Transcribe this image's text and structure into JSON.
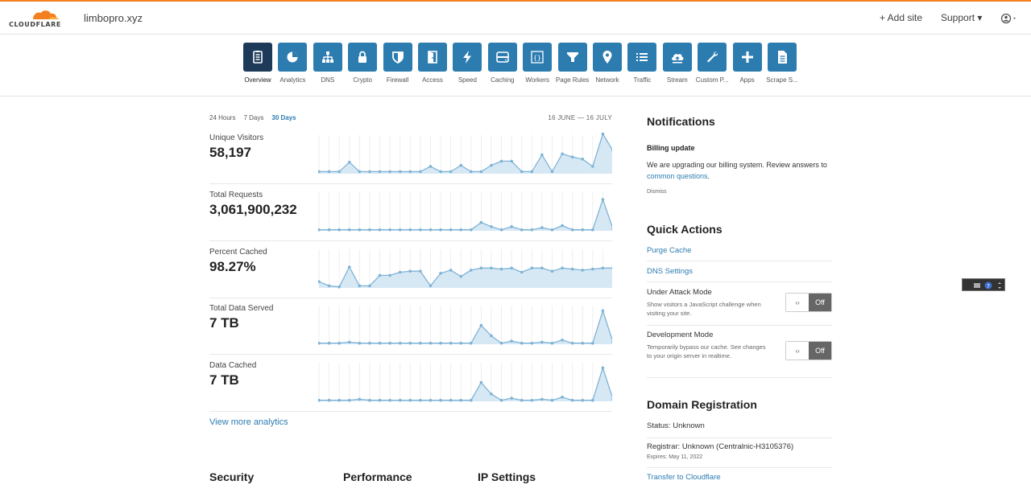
{
  "header": {
    "logo_text": "CLOUDFLARE",
    "domain": "limbopro.xyz",
    "add_site": "+ Add site",
    "support": "Support ▾",
    "account_icon": "user-circle-icon"
  },
  "nav": [
    {
      "label": "Overview",
      "icon": "overview-icon",
      "active": true
    },
    {
      "label": "Analytics",
      "icon": "pie-chart-icon"
    },
    {
      "label": "DNS",
      "icon": "network-tree-icon"
    },
    {
      "label": "Crypto",
      "icon": "lock-icon"
    },
    {
      "label": "Firewall",
      "icon": "shield-icon"
    },
    {
      "label": "Access",
      "icon": "door-icon"
    },
    {
      "label": "Speed",
      "icon": "lightning-icon"
    },
    {
      "label": "Caching",
      "icon": "drive-icon"
    },
    {
      "label": "Workers",
      "icon": "code-braces-icon"
    },
    {
      "label": "Page Rules",
      "icon": "filter-icon"
    },
    {
      "label": "Network",
      "icon": "location-pin-icon"
    },
    {
      "label": "Traffic",
      "icon": "list-icon"
    },
    {
      "label": "Stream",
      "icon": "cloud-upload-icon"
    },
    {
      "label": "Custom P...",
      "icon": "wrench-icon"
    },
    {
      "label": "Apps",
      "icon": "plus-icon"
    },
    {
      "label": "Scrape S...",
      "icon": "document-icon"
    }
  ],
  "analytics": {
    "ranges": [
      "24 Hours",
      "7 Days",
      "30 Days"
    ],
    "active_range": "30 Days",
    "date_range": "16 JUNE — 16 JULY",
    "view_more": "View more analytics",
    "stats": [
      {
        "label": "Unique Visitors",
        "value": "58,197",
        "series": [
          0.1,
          0.1,
          0.1,
          0.55,
          0.1,
          0.1,
          0.1,
          0.1,
          0.1,
          0.1,
          0.1,
          0.35,
          0.1,
          0.1,
          0.4,
          0.1,
          0.1,
          0.4,
          0.6,
          0.6,
          0.1,
          0.1,
          0.9,
          0.1,
          0.95,
          0.8,
          0.7,
          0.35,
          1.9,
          1.1
        ]
      },
      {
        "label": "Total Requests",
        "value": "3,061,900,232",
        "series": [
          0.05,
          0.05,
          0.05,
          0.05,
          0.05,
          0.05,
          0.05,
          0.05,
          0.05,
          0.05,
          0.05,
          0.05,
          0.05,
          0.05,
          0.05,
          0.05,
          0.4,
          0.2,
          0.05,
          0.2,
          0.05,
          0.05,
          0.15,
          0.05,
          0.25,
          0.05,
          0.05,
          0.05,
          1.5,
          0.1
        ]
      },
      {
        "label": "Percent Cached",
        "value": "98.27%",
        "series": [
          0.3,
          0.1,
          0.05,
          1.0,
          0.1,
          0.1,
          0.6,
          0.6,
          0.75,
          0.8,
          0.8,
          0.1,
          0.7,
          0.85,
          0.55,
          0.85,
          0.95,
          0.95,
          0.9,
          0.95,
          0.75,
          0.95,
          0.95,
          0.8,
          0.95,
          0.9,
          0.85,
          0.9,
          0.95,
          0.95
        ]
      },
      {
        "label": "Total Data Served",
        "value": "7 TB",
        "series": [
          0.05,
          0.05,
          0.05,
          0.1,
          0.05,
          0.05,
          0.05,
          0.05,
          0.05,
          0.05,
          0.05,
          0.05,
          0.05,
          0.05,
          0.05,
          0.05,
          0.9,
          0.4,
          0.05,
          0.15,
          0.05,
          0.05,
          0.1,
          0.05,
          0.2,
          0.05,
          0.05,
          0.05,
          1.6,
          0.1
        ]
      },
      {
        "label": "Data Cached",
        "value": "7 TB",
        "series": [
          0.05,
          0.05,
          0.05,
          0.05,
          0.1,
          0.05,
          0.05,
          0.05,
          0.05,
          0.05,
          0.05,
          0.05,
          0.05,
          0.05,
          0.05,
          0.05,
          0.9,
          0.35,
          0.05,
          0.15,
          0.05,
          0.05,
          0.1,
          0.05,
          0.2,
          0.05,
          0.05,
          0.05,
          1.6,
          0.1
        ]
      }
    ],
    "spark_color": "#7fb3d5",
    "spark_fill": "#d7e8f5"
  },
  "bottom_sections": [
    "Security",
    "Performance",
    "IP Settings"
  ],
  "notifications": {
    "heading": "Notifications",
    "title": "Billing update",
    "body_prefix": "We are upgrading our billing system. Review answers to ",
    "link": "common questions",
    "body_suffix": ".",
    "dismiss": "Dismiss"
  },
  "quick_actions": {
    "heading": "Quick Actions",
    "purge_cache": "Purge Cache",
    "dns_settings": "DNS Settings",
    "under_attack": {
      "title": "Under Attack Mode",
      "desc": "Show visitors a JavaScript challenge when visiting your site.",
      "toggle": "Off",
      "handle": "‹›"
    },
    "dev_mode": {
      "title": "Development Mode",
      "desc": "Temporarily bypass our cache. See changes to your origin server in realtime.",
      "toggle": "Off",
      "handle": "‹›"
    }
  },
  "domain_registration": {
    "heading": "Domain Registration",
    "status": "Status: Unknown",
    "registrar": "Registrar: Unknown (Centralnic-H3105376)",
    "expires": "Expires: May 11, 2022",
    "transfer": "Transfer to Cloudflare"
  },
  "colors": {
    "accent": "#2c7cb0",
    "active_tile": "#1d3a58",
    "brand_orange": "#f38020"
  }
}
